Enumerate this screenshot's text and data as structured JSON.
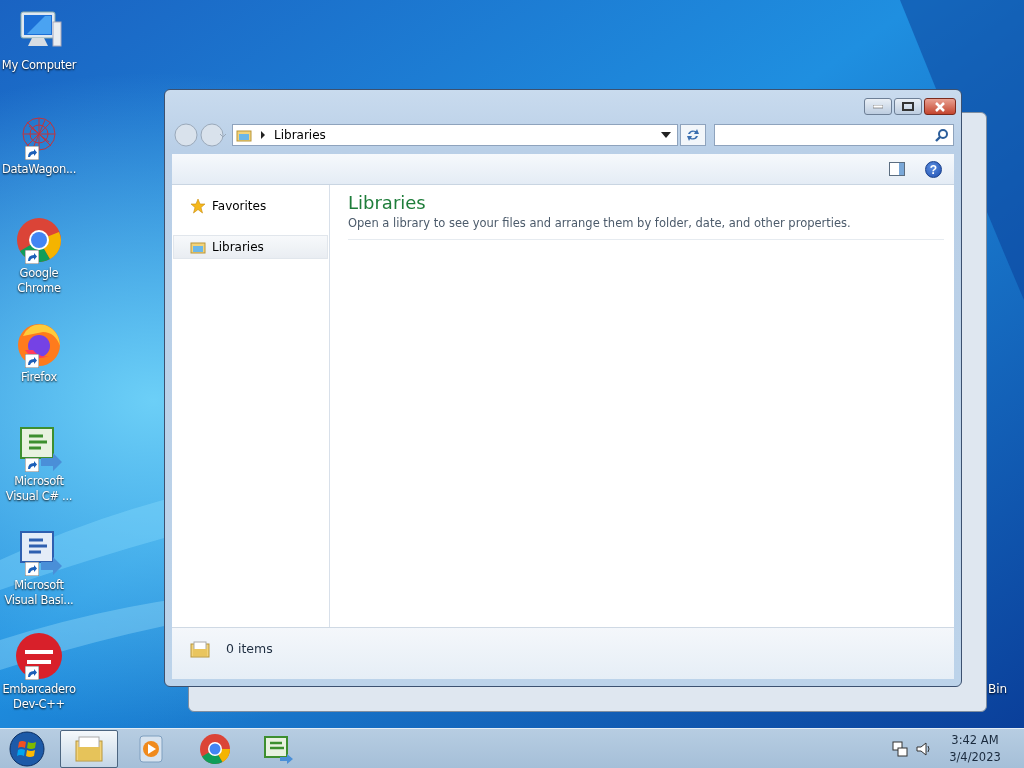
{
  "desktop_icons": [
    {
      "kind": "computer",
      "label": "My Computer",
      "shortcut": false
    },
    {
      "kind": "network",
      "label": "DataWagon...",
      "shortcut": true
    },
    {
      "kind": "chrome",
      "label": "Google Chrome",
      "shortcut": true
    },
    {
      "kind": "firefox",
      "label": "Firefox",
      "shortcut": true
    },
    {
      "kind": "csharp",
      "label": "Microsoft Visual C# ...",
      "shortcut": true
    },
    {
      "kind": "vb",
      "label": "Microsoft Visual Basi...",
      "shortcut": true
    },
    {
      "kind": "dev",
      "label": "Embarcadero Dev-C++",
      "shortcut": true
    }
  ],
  "recycle_bin": {
    "label": "Bin"
  },
  "window": {
    "address": {
      "crumbs": [
        "Libraries"
      ]
    },
    "toolbar": {
      "help": "?"
    },
    "nav_pane": [
      {
        "kind": "star",
        "label": "Favorites",
        "selected": false
      },
      {
        "kind": "folder",
        "label": "Libraries",
        "selected": true
      }
    ],
    "content": {
      "title": "Libraries",
      "description": "Open a library to see your files and arrange them by folder, date, and other properties."
    },
    "status_bar": {
      "text": "0 items"
    }
  },
  "taskbar": {
    "items": [
      {
        "kind": "explorer",
        "active": true
      },
      {
        "kind": "media",
        "active": false
      },
      {
        "kind": "chrome",
        "active": false
      },
      {
        "kind": "csharp",
        "active": false
      }
    ],
    "clock": {
      "time": "3:42 AM",
      "date": "3/4/2023"
    }
  }
}
